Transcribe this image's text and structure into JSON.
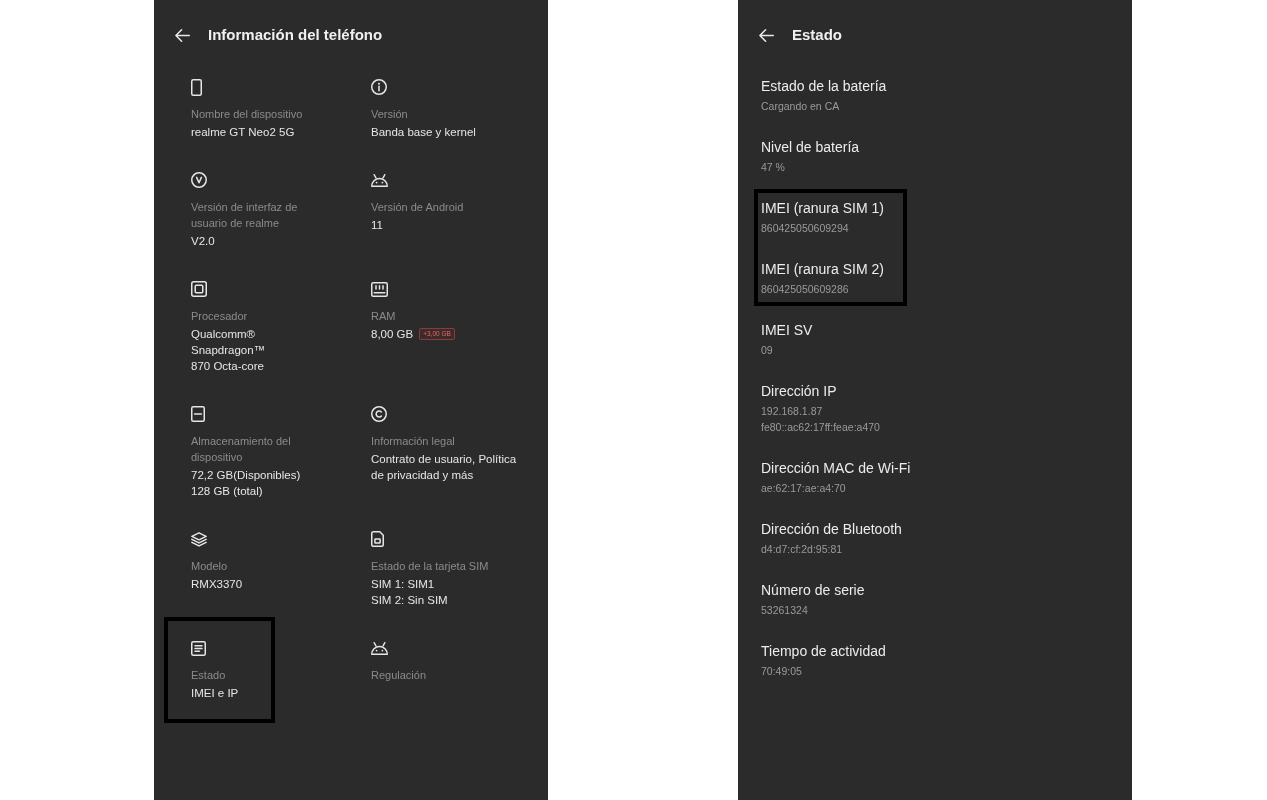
{
  "left_screen": {
    "title": "Información del teléfono",
    "items": [
      {
        "label": "Nombre del dispositivo",
        "value": [
          "realme GT Neo2 5G"
        ],
        "highlighted": false
      },
      {
        "label": "Versión",
        "value": [
          "Banda base y kernel"
        ],
        "highlighted": false
      },
      {
        "label": "Versión de interfaz de usuario de realme",
        "value": [
          "V2.0"
        ],
        "highlighted": false
      },
      {
        "label": "Versión de Android",
        "value": [
          "11"
        ],
        "highlighted": false
      },
      {
        "label": "Procesador",
        "value": [
          "Qualcomm®",
          "Snapdragon™",
          "870 Octa-core"
        ],
        "highlighted": false
      },
      {
        "label": "RAM",
        "value": [
          "8,00 GB"
        ],
        "badge": "+3,00 GB",
        "highlighted": false
      },
      {
        "label": "Almacenamiento del dispositivo",
        "value": [
          "72,2 GB(Disponibles)",
          "128 GB (total)"
        ],
        "highlighted": false
      },
      {
        "label": "Información legal",
        "value": [
          "Contrato de usuario, Política de privacidad y más"
        ],
        "highlighted": false
      },
      {
        "label": "Modelo",
        "value": [
          "RMX3370"
        ],
        "highlighted": false
      },
      {
        "label": "Estado de la tarjeta SIM",
        "value": [
          "SIM 1: SIM1",
          "SIM 2: Sin SIM"
        ],
        "highlighted": false
      },
      {
        "label": "Estado",
        "value": [
          "IMEI e IP"
        ],
        "highlighted": true
      },
      {
        "label": "Regulación",
        "highlighted": false
      }
    ]
  },
  "right_screen": {
    "title": "Estado",
    "items": [
      {
        "title": "Estado de la batería",
        "value": [
          "Cargando en CA"
        ],
        "highlighted": false
      },
      {
        "title": "Nivel de batería",
        "value": [
          "47 %"
        ],
        "highlighted": false
      },
      {
        "title": "IMEI (ranura SIM 1)",
        "value": [
          "860425050609294"
        ],
        "highlighted": true
      },
      {
        "title": "IMEI (ranura SIM 2)",
        "value": [
          "860425050609286"
        ],
        "highlighted": true
      },
      {
        "title": "IMEI SV",
        "value": [
          "09"
        ],
        "highlighted": false
      },
      {
        "title": "Dirección IP",
        "value": [
          "192.168.1.87",
          "fe80::ac62:17ff:feae:a470"
        ],
        "highlighted": false
      },
      {
        "title": "Dirección MAC de Wi-Fi",
        "value": [
          "ae:62:17:ae:a4:70"
        ],
        "highlighted": false
      },
      {
        "title": "Dirección de Bluetooth",
        "value": [
          "d4:d7:cf:2d:95:81"
        ],
        "highlighted": false
      },
      {
        "title": "Número de serie",
        "value": [
          "53261324"
        ],
        "highlighted": false
      },
      {
        "title": "Tiempo de actividad",
        "value": [
          "70:49:05"
        ],
        "highlighted": false
      }
    ]
  }
}
